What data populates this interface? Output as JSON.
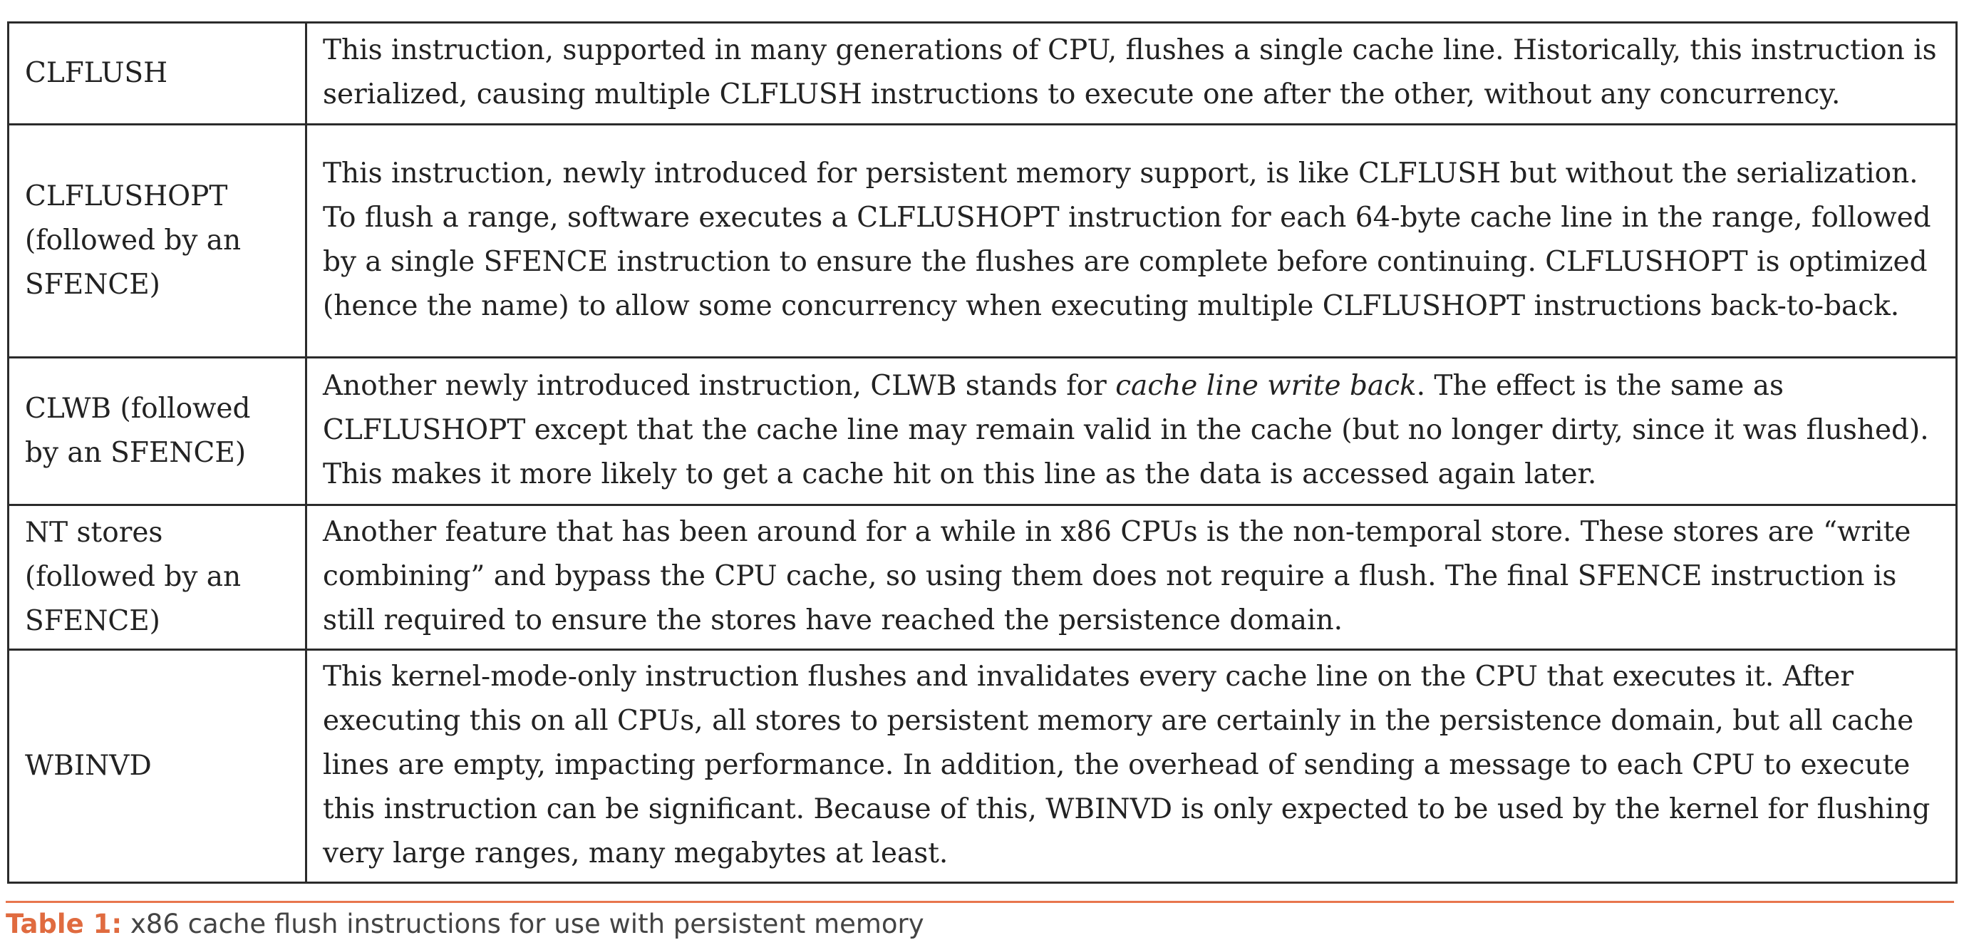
{
  "table": {
    "rows": [
      {
        "name": "CLFLUSH",
        "description": "This instruction, supported in many generations of CPU, flushes a single cache line. Historically, this instruction is serialized, causing multiple CLFLUSH instructions to execute one after the other, without any concurrency."
      },
      {
        "name": "CLFLUSHOPT (followed by an SFENCE)",
        "description": "This instruction, newly introduced for persistent memory support, is like CLFLUSH but without the serialization. To flush a range, software executes a CLFLUSHOPT instruction for each 64-byte cache line in the range, followed by a single SFENCE instruction to ensure the flushes are complete before continuing. CLFLUSHOPT is optimized (hence the name) to allow some concurrency when executing multiple CLFLUSHOPT instructions back-to-back."
      },
      {
        "name": "CLWB (followed by an SFENCE)",
        "description_before": "Another newly introduced instruction, CLWB stands for ",
        "description_emphasis": "cache line write back",
        "description_after": ". The effect is the same as CLFLUSHOPT except that the cache line may remain valid in the cache (but no longer dirty, since it was flushed). This makes it more likely to get a cache hit on this line as the data is accessed again later."
      },
      {
        "name": "NT stores (followed by an SFENCE)",
        "description": "Another feature that has been around for a while in x86 CPUs is the non-temporal store. These stores are “write combining” and bypass the CPU cache, so using them does not require a flush. The final SFENCE instruction is still required to ensure the stores have reached the persistence domain."
      },
      {
        "name": "WBINVD",
        "description": "This kernel-mode-only instruction flushes and invalidates every cache line on the CPU that executes it. After executing this on all CPUs, all stores to persistent memory are certainly in the persistence domain, but all cache lines are empty, impacting performance. In addition, the overhead of sending a message to each CPU to execute this instruction can be significant. Because of this, WBINVD is only expected to be used by the kernel for flushing very large ranges, many megabytes at least."
      }
    ]
  },
  "caption": {
    "label": "Table 1:",
    "text": " x86 cache flush instructions for use with persistent memory"
  },
  "colors": {
    "border": "#2b2b2b",
    "accent": "#e06b3f",
    "rule": "#e8764e",
    "text": "#222222"
  }
}
